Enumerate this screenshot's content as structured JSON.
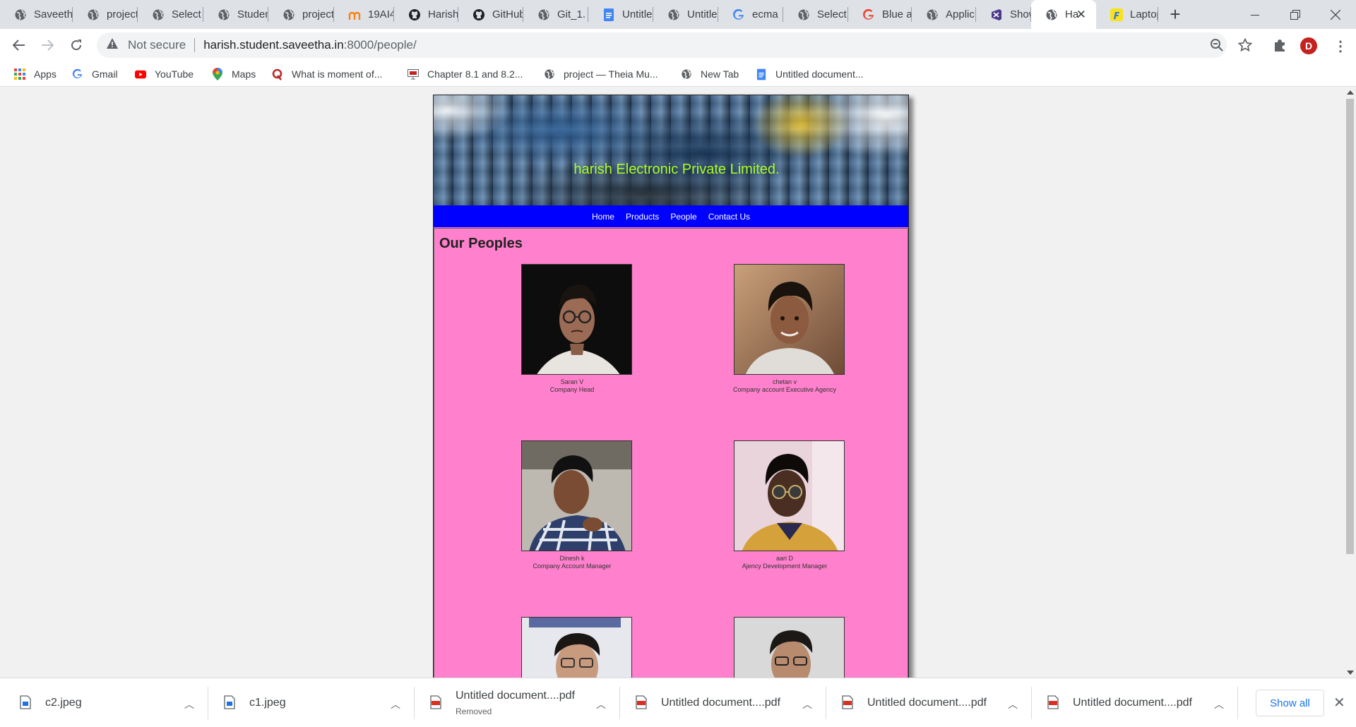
{
  "tabs": [
    {
      "title": "Saveetha",
      "icon": "globe"
    },
    {
      "title": "project",
      "icon": "globe"
    },
    {
      "title": "Select",
      "icon": "globe"
    },
    {
      "title": "Student",
      "icon": "globe"
    },
    {
      "title": "project",
      "icon": "globe"
    },
    {
      "title": "19AI4",
      "icon": "m-orange"
    },
    {
      "title": "Harish",
      "icon": "github"
    },
    {
      "title": "GitHub",
      "icon": "github"
    },
    {
      "title": "Git_1.",
      "icon": "globe"
    },
    {
      "title": "Untitled",
      "icon": "docs"
    },
    {
      "title": "Untitled",
      "icon": "globe"
    },
    {
      "title": "ecma",
      "icon": "google"
    },
    {
      "title": "Select",
      "icon": "globe"
    },
    {
      "title": "Blue a",
      "icon": "google"
    },
    {
      "title": "Applic",
      "icon": "globe"
    },
    {
      "title": "Show",
      "icon": "vs"
    },
    {
      "title": "Ha",
      "icon": "globe",
      "active": true
    },
    {
      "title": "Laptop",
      "icon": "flipkart"
    }
  ],
  "address": {
    "security": "Not secure",
    "host": "harish.student.saveetha.in",
    "path": ":8000/people/"
  },
  "bookmarks": [
    {
      "label": "Apps",
      "icon": "apps"
    },
    {
      "label": "Gmail",
      "icon": "google"
    },
    {
      "label": "YouTube",
      "icon": "youtube"
    },
    {
      "label": "Maps",
      "icon": "maps"
    },
    {
      "label": "What is moment of...",
      "icon": "quora"
    },
    {
      "label": "Chapter 8.1 and 8.2...",
      "icon": "slides"
    },
    {
      "label": "project — Theia Mu...",
      "icon": "globe"
    },
    {
      "label": "New Tab",
      "icon": "globe"
    },
    {
      "label": "Untitled document...",
      "icon": "docs"
    }
  ],
  "site": {
    "company": "harish Electronic Private Limited.",
    "nav": [
      "Home",
      "Products",
      "People",
      "Contact Us"
    ],
    "heading": "Our Peoples",
    "people": [
      {
        "name": "Saran V",
        "role": "Company Head"
      },
      {
        "name": "chetan v",
        "role": "Company account Executive Agency"
      },
      {
        "name": "Dinesh k",
        "role": "Company Account Manager"
      },
      {
        "name": "aari D",
        "role": "Ajency Development Manager"
      }
    ]
  },
  "downloads": [
    {
      "name": "c2.jpeg",
      "status": "",
      "type": "jpeg"
    },
    {
      "name": "c1.jpeg",
      "status": "",
      "type": "jpeg"
    },
    {
      "name": "Untitled document....pdf",
      "status": "Removed",
      "type": "pdf"
    },
    {
      "name": "Untitled document....pdf",
      "status": "",
      "type": "pdf"
    },
    {
      "name": "Untitled document....pdf",
      "status": "",
      "type": "pdf"
    },
    {
      "name": "Untitled document....pdf",
      "status": "",
      "type": "pdf"
    }
  ],
  "download_bar": {
    "show_all": "Show all"
  },
  "profile": {
    "initial": "D"
  },
  "colors": {
    "nav_bar": "#0000ff",
    "content_bg": "#ff80cc",
    "company_text": "#aaff22",
    "avatar": "#c5221f"
  }
}
